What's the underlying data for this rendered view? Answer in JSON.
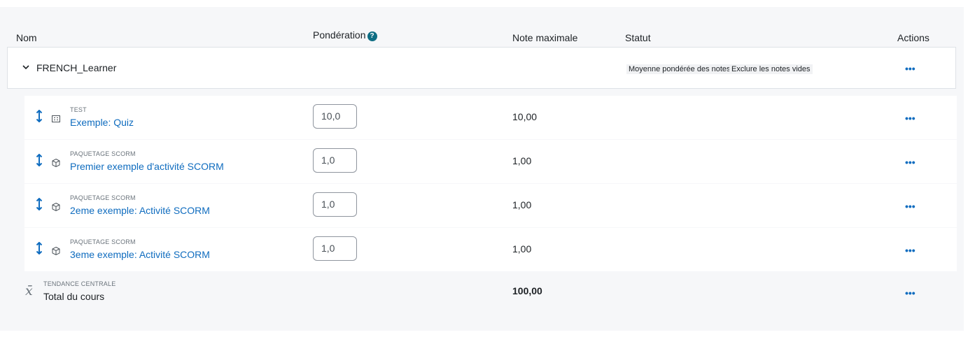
{
  "header": {
    "name": "Nom",
    "weight": "Pondération",
    "max_grade": "Note maximale",
    "status": "Statut",
    "actions": "Actions"
  },
  "category": {
    "name": "FRENCH_Learner",
    "status_badges": [
      "Moyenne pondérée des notes",
      "Exclure les notes vides"
    ]
  },
  "items": [
    {
      "type": "TEST",
      "icon": "quiz-icon",
      "name": "Exemple: Quiz",
      "weight": "10,0",
      "max_grade": "10,00"
    },
    {
      "type": "PAQUETAGE SCORM",
      "icon": "scorm-package-icon",
      "name": "Premier exemple d'activité SCORM",
      "weight": "1,0",
      "max_grade": "1,00"
    },
    {
      "type": "PAQUETAGE SCORM",
      "icon": "scorm-package-icon",
      "name": "2eme exemple: Activité SCORM",
      "weight": "1,0",
      "max_grade": "1,00"
    },
    {
      "type": "PAQUETAGE SCORM",
      "icon": "scorm-package-icon",
      "name": "3eme exemple: Activité SCORM",
      "weight": "1,0",
      "max_grade": "1,00"
    }
  ],
  "total": {
    "type": "TENDANCE CENTRALE",
    "name": "Total du cours",
    "max_grade": "100,00"
  },
  "colors": {
    "link": "#0f6cbf",
    "help": "#0f6e84"
  }
}
